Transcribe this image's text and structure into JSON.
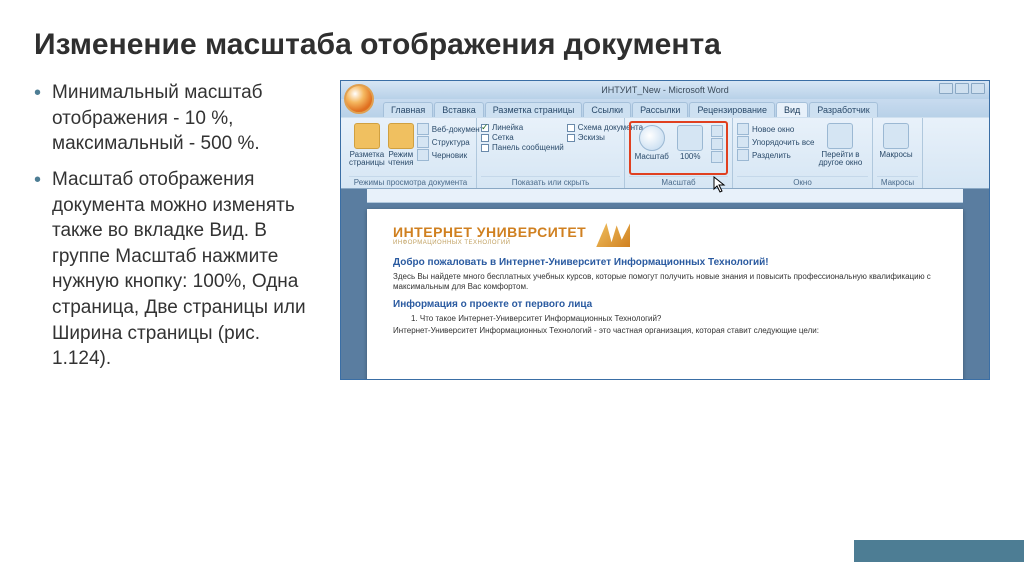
{
  "slide": {
    "title": "Изменение масштаба отображения документа",
    "bullets": [
      "Минимальный масштаб отображения - 10 %, максимальный - 500 %.",
      "Масштаб отображения документа можно изменять также во вкладке Вид. В группе Масштаб нажмите нужную кнопку: 100%, Одна страница, Две страницы или Ширина страницы (рис. 1.124)."
    ]
  },
  "word": {
    "title": "ИНТУИТ_New - Microsoft Word",
    "tabs": [
      "Главная",
      "Вставка",
      "Разметка страницы",
      "Ссылки",
      "Рассылки",
      "Рецензирование",
      "Вид",
      "Разработчик"
    ],
    "active_tab": "Вид",
    "groups": {
      "views": {
        "label": "Режимы просмотра документа",
        "btn1": "Разметка страницы",
        "btn2": "Режим чтения",
        "items": [
          "Веб-документ",
          "Структура",
          "Черновик"
        ]
      },
      "show": {
        "label": "Показать или скрыть",
        "items": [
          "Линейка",
          "Сетка",
          "Панель сообщений",
          "Схема документа",
          "Эскизы"
        ]
      },
      "zoom": {
        "label": "Масштаб",
        "btn1": "Масштаб",
        "btn2": "100%"
      },
      "window": {
        "label": "Окно",
        "items": [
          "Новое окно",
          "Упорядочить все",
          "Разделить"
        ],
        "btn": "Перейти в другое окно"
      },
      "macros": {
        "label": "Макросы",
        "btn": "Макросы"
      }
    },
    "doc": {
      "brand": "ИНТЕРНЕТ УНИВЕРСИТЕТ",
      "brand_sub": "ИНФОРМАЦИОННЫХ ТЕХНОЛОГИЙ",
      "h1": "Добро пожаловать в Интернет-Университет Информационных Технологий!",
      "p1": "Здесь Вы найдете много бесплатных учебных курсов, которые помогут получить новые знания и повысить профессиональную квалификацию с максимальным для Вас комфортом.",
      "h2": "Информация о проекте от первого лица",
      "li1": "1.   Что такое Интернет-Университет Информационных Технологий?",
      "p2": "Интернет-Университет Информационных Технологий - это частная организация, которая ставит следующие цели:"
    }
  }
}
